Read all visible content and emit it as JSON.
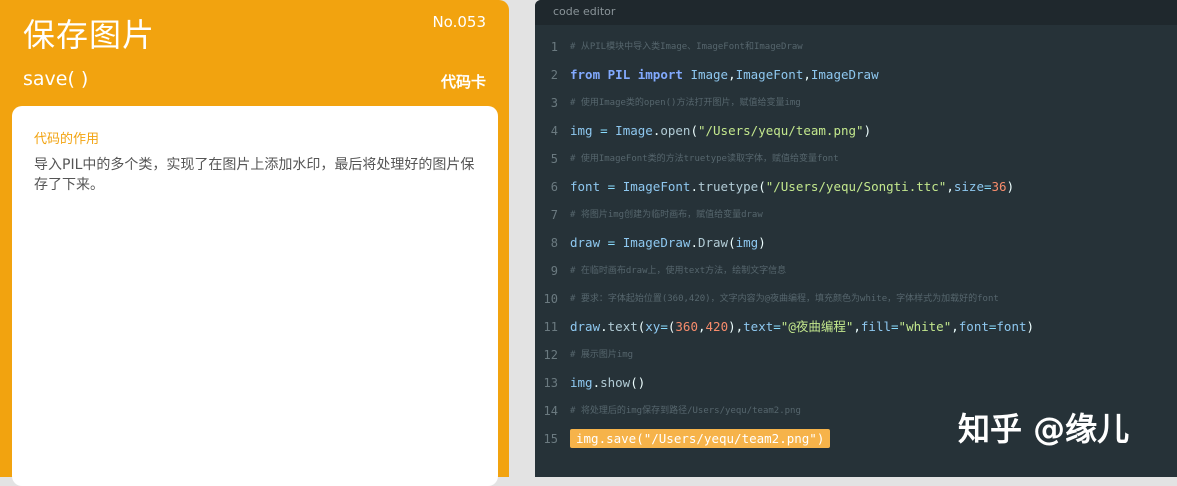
{
  "card": {
    "title": "保存图片",
    "number": "No.053",
    "function": "save( )",
    "tag": "代码卡",
    "section_label": "代码的作用",
    "description": "导入PIL中的多个类，实现了在图片上添加水印，最后将处理好的图片保存了下来。"
  },
  "editor": {
    "title": "code editor",
    "lines": [
      {
        "n": "1",
        "comment": "# 从PIL模块中导入类Image、ImageFont和ImageDraw"
      },
      {
        "n": "2",
        "tokens": [
          [
            "kw",
            "from "
          ],
          [
            "kw",
            "PIL "
          ],
          [
            "kw",
            "import "
          ],
          [
            "name",
            "Image"
          ],
          [
            "pr",
            ","
          ],
          [
            "name",
            "ImageFont"
          ],
          [
            "pr",
            ","
          ],
          [
            "name",
            "ImageDraw"
          ]
        ]
      },
      {
        "n": "3",
        "comment": "# 使用Image类的open()方法打开图片，赋值给变量img"
      },
      {
        "n": "4",
        "tokens": [
          [
            "name",
            "img "
          ],
          [
            "op",
            "= "
          ],
          [
            "name",
            "Image"
          ],
          [
            "pr",
            "."
          ],
          [
            "fn",
            "open"
          ],
          [
            "pr",
            "("
          ],
          [
            "str",
            "\"/Users/yequ/team.png\""
          ],
          [
            "pr",
            ")"
          ]
        ]
      },
      {
        "n": "5",
        "comment": "# 使用ImageFont类的方法truetype读取字体，赋值给变量font"
      },
      {
        "n": "6",
        "tokens": [
          [
            "name",
            "font "
          ],
          [
            "op",
            "= "
          ],
          [
            "name",
            "ImageFont"
          ],
          [
            "pr",
            "."
          ],
          [
            "fn",
            "truetype"
          ],
          [
            "pr",
            "("
          ],
          [
            "str",
            "\"/Users/yequ/Songti.ttc\""
          ],
          [
            "pr",
            ","
          ],
          [
            "name",
            "size"
          ],
          [
            "op",
            "="
          ],
          [
            "num",
            "36"
          ],
          [
            "pr",
            ")"
          ]
        ]
      },
      {
        "n": "7",
        "comment": "# 将图片img创建为临时画布，赋值给变量draw"
      },
      {
        "n": "8",
        "tokens": [
          [
            "name",
            "draw "
          ],
          [
            "op",
            "= "
          ],
          [
            "name",
            "ImageDraw"
          ],
          [
            "pr",
            "."
          ],
          [
            "fn",
            "Draw"
          ],
          [
            "pr",
            "("
          ],
          [
            "name",
            "img"
          ],
          [
            "pr",
            ")"
          ]
        ]
      },
      {
        "n": "9",
        "comment": "# 在临时画布draw上，使用text方法，绘制文字信息"
      },
      {
        "n": "10",
        "comment": "# 要求：字体起始位置(360,420)，文字内容为@夜曲编程，填充颜色为white，字体样式为加载好的font"
      },
      {
        "n": "11",
        "tokens": [
          [
            "name",
            "draw"
          ],
          [
            "pr",
            "."
          ],
          [
            "fn",
            "text"
          ],
          [
            "pr",
            "("
          ],
          [
            "name",
            "xy"
          ],
          [
            "op",
            "="
          ],
          [
            "pr",
            "("
          ],
          [
            "num",
            "360"
          ],
          [
            "pr",
            ","
          ],
          [
            "num",
            "420"
          ],
          [
            "pr",
            "),"
          ],
          [
            "name",
            "text"
          ],
          [
            "op",
            "="
          ],
          [
            "str",
            "\"@夜曲编程\""
          ],
          [
            "pr",
            ","
          ],
          [
            "name",
            "fill"
          ],
          [
            "op",
            "="
          ],
          [
            "str",
            "\"white\""
          ],
          [
            "pr",
            ","
          ],
          [
            "name",
            "font"
          ],
          [
            "op",
            "="
          ],
          [
            "name",
            "font"
          ],
          [
            "pr",
            ")"
          ]
        ]
      },
      {
        "n": "12",
        "comment": "# 展示图片img"
      },
      {
        "n": "13",
        "tokens": [
          [
            "name",
            "img"
          ],
          [
            "pr",
            "."
          ],
          [
            "fn",
            "show"
          ],
          [
            "pr",
            "()"
          ]
        ]
      },
      {
        "n": "14",
        "comment": "# 将处理后的img保存到路径/Users/yequ/team2.png"
      },
      {
        "n": "15",
        "highlight": "img.save(\"/Users/yequ/team2.png\")"
      }
    ]
  },
  "watermark": "知乎 @缘儿"
}
